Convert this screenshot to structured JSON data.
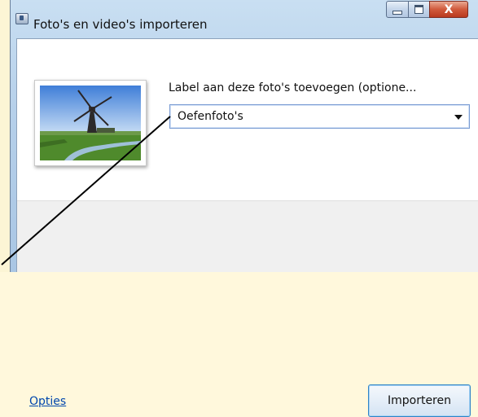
{
  "window": {
    "title": "Foto's en video's importeren"
  },
  "dialog": {
    "thumbnail_icon": "windmill-photo-thumbnail",
    "tag_label": "Label aan deze foto's toevoegen (optione...",
    "tag_value": "Oefenfoto's",
    "options_link": "Opties",
    "import_button": "Importeren"
  },
  "titlebar": {
    "close_glyph": "X"
  },
  "colors": {
    "link": "#0046ad",
    "close_button": "#c9482b",
    "titlebar": "#b6d0ea"
  }
}
